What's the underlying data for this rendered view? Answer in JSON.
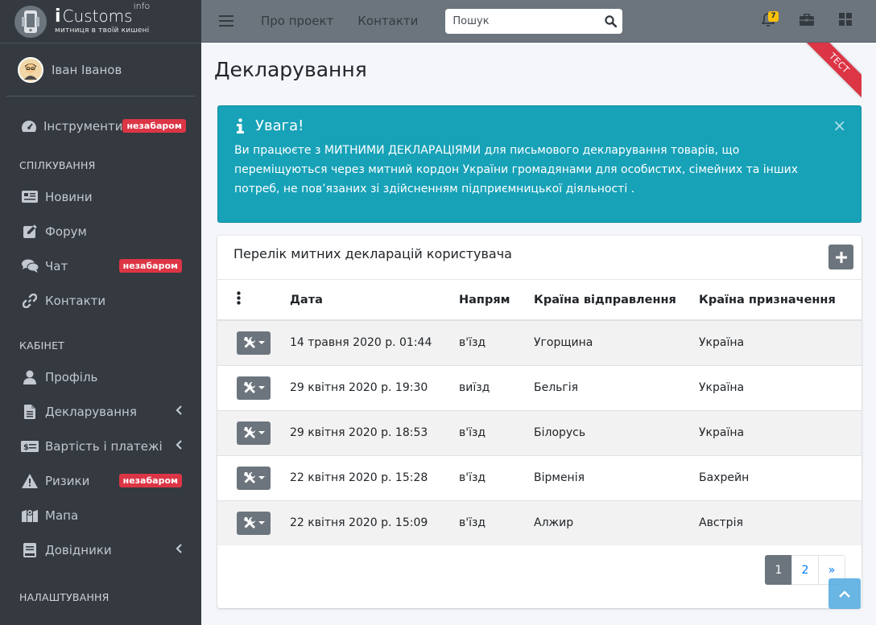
{
  "brand": {
    "name_prefix": "i",
    "name": "Customs",
    "name_sup": "info",
    "tagline": "митниця в твоїй кишені"
  },
  "user": {
    "name": "Іван Іванов"
  },
  "sidebar": {
    "top_items": [
      {
        "label": "Інструменти",
        "icon": "gauge-icon",
        "badge": "незабаром"
      }
    ],
    "sections": [
      {
        "header": "СПІЛКУВАННЯ",
        "items": [
          {
            "label": "Новини",
            "icon": "newspaper-icon"
          },
          {
            "label": "Форум",
            "icon": "edit-icon"
          },
          {
            "label": "Чат",
            "icon": "comments-icon",
            "badge": "незабаром"
          },
          {
            "label": "Контакти",
            "icon": "link-icon"
          }
        ]
      },
      {
        "header": "КАБІНЕТ",
        "items": [
          {
            "label": "Профіль",
            "icon": "user-icon"
          },
          {
            "label": "Декларування",
            "icon": "file-icon",
            "chevron": true
          },
          {
            "label": "Вартість і платежі",
            "icon": "money-icon",
            "chevron": true
          },
          {
            "label": "Ризики",
            "icon": "warning-icon",
            "badge": "незабаром"
          },
          {
            "label": "Мапа",
            "icon": "map-icon"
          },
          {
            "label": "Довідники",
            "icon": "book-icon",
            "chevron": true
          }
        ]
      },
      {
        "header": "НАЛАШТУВАННЯ",
        "items": []
      }
    ]
  },
  "topbar": {
    "links": [
      "Про проект",
      "Контакти"
    ],
    "search_placeholder": "Пошук",
    "notifications_count": "7"
  },
  "page": {
    "title": "Декларування",
    "ribbon": "ТЕСТ"
  },
  "alert": {
    "title": "Увага!",
    "text": "Ви працюєте з МИТНИМИ ДЕКЛАРАЦІЯМИ для письмового декларування товарів, що переміщуються через митний кордон України громадянами для особистих, сімейних та інших потреб, не пов’язаних зі здійсненням підприємницької діяльності .",
    "close": "×"
  },
  "declarations": {
    "card_title": "Перелік митних декларацій користувача",
    "columns": [
      "Дата",
      "Напрям",
      "Країна відправлення",
      "Країна призначення"
    ],
    "rows": [
      {
        "date": "14 травня 2020 р. 01:44",
        "direction": "в'їзд",
        "from": "Угорщина",
        "to": "Україна"
      },
      {
        "date": "29 квітня 2020 р. 19:30",
        "direction": "виїзд",
        "from": "Бельгія",
        "to": "Україна"
      },
      {
        "date": "29 квітня 2020 р. 18:53",
        "direction": "в'їзд",
        "from": "Білорусь",
        "to": "Україна"
      },
      {
        "date": "22 квітня 2020 р. 15:28",
        "direction": "в'їзд",
        "from": "Вірменія",
        "to": "Бахрейн"
      },
      {
        "date": "22 квітня 2020 р. 15:09",
        "direction": "в'їзд",
        "from": "Алжир",
        "to": "Австрія"
      }
    ],
    "pagination": {
      "pages": [
        "1",
        "2"
      ],
      "next": "»",
      "current": "1"
    }
  },
  "colors": {
    "sidebar_bg": "#343a40",
    "topbar_bg": "#6c757d",
    "alert_bg": "#17a2b8",
    "badge_red": "#dc3545",
    "link_blue": "#007bff"
  }
}
